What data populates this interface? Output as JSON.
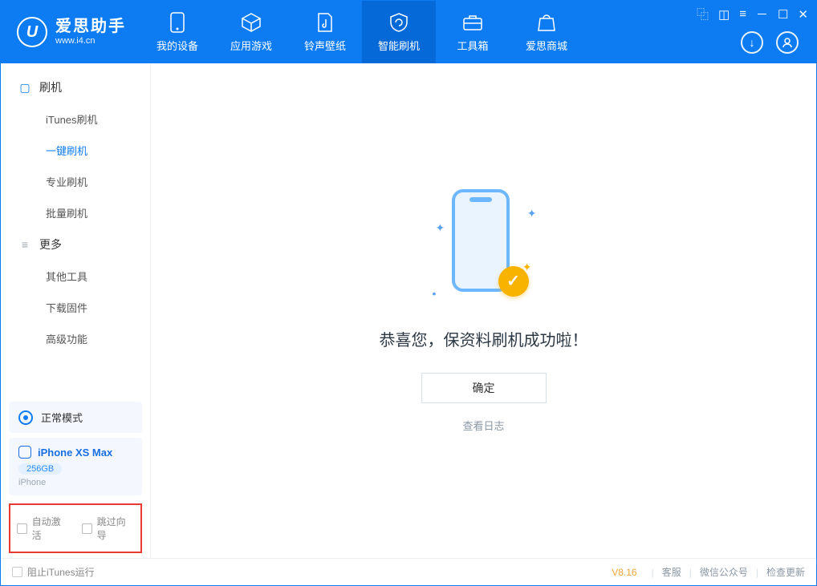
{
  "app": {
    "name": "爱思助手",
    "domain": "www.i4.cn",
    "logo_letter": "U"
  },
  "header_tabs": [
    {
      "label": "我的设备"
    },
    {
      "label": "应用游戏"
    },
    {
      "label": "铃声壁纸"
    },
    {
      "label": "智能刷机"
    },
    {
      "label": "工具箱"
    },
    {
      "label": "爱思商城"
    }
  ],
  "sidebar": {
    "cat1": "刷机",
    "items1": [
      {
        "label": "iTunes刷机"
      },
      {
        "label": "一键刷机"
      },
      {
        "label": "专业刷机"
      },
      {
        "label": "批量刷机"
      }
    ],
    "cat2": "更多",
    "items2": [
      {
        "label": "其他工具"
      },
      {
        "label": "下载固件"
      },
      {
        "label": "高级功能"
      }
    ],
    "mode": "正常模式",
    "device": {
      "name": "iPhone XS Max",
      "capacity": "256GB",
      "type": "iPhone"
    },
    "opts": {
      "auto_activate": "自动激活",
      "skip_guide": "跳过向导"
    }
  },
  "main": {
    "message": "恭喜您，保资料刷机成功啦！",
    "ok": "确定",
    "view_log": "查看日志"
  },
  "footer": {
    "block_itunes": "阻止iTunes运行",
    "version": "V8.16",
    "links": [
      "客服",
      "微信公众号",
      "检查更新"
    ]
  }
}
